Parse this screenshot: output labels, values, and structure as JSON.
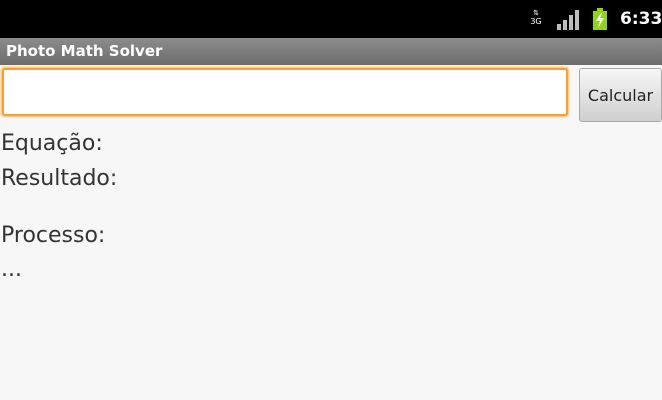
{
  "status_bar": {
    "network_type": "3G",
    "network_activity": "⇅",
    "signal_icon": "signal-bars-icon",
    "battery_icon": "battery-charging-icon",
    "time": "6:33"
  },
  "title_bar": {
    "title": "Photo Math Solver"
  },
  "form": {
    "equation_value": "",
    "calculate_label": "Calcular"
  },
  "results": {
    "equation_label": "Equação:",
    "result_label": "Resultado:",
    "process_label": "Processo:",
    "process_value": "..."
  },
  "colors": {
    "focus_accent": "#f3a13b",
    "battery_green": "#8fd31d"
  }
}
